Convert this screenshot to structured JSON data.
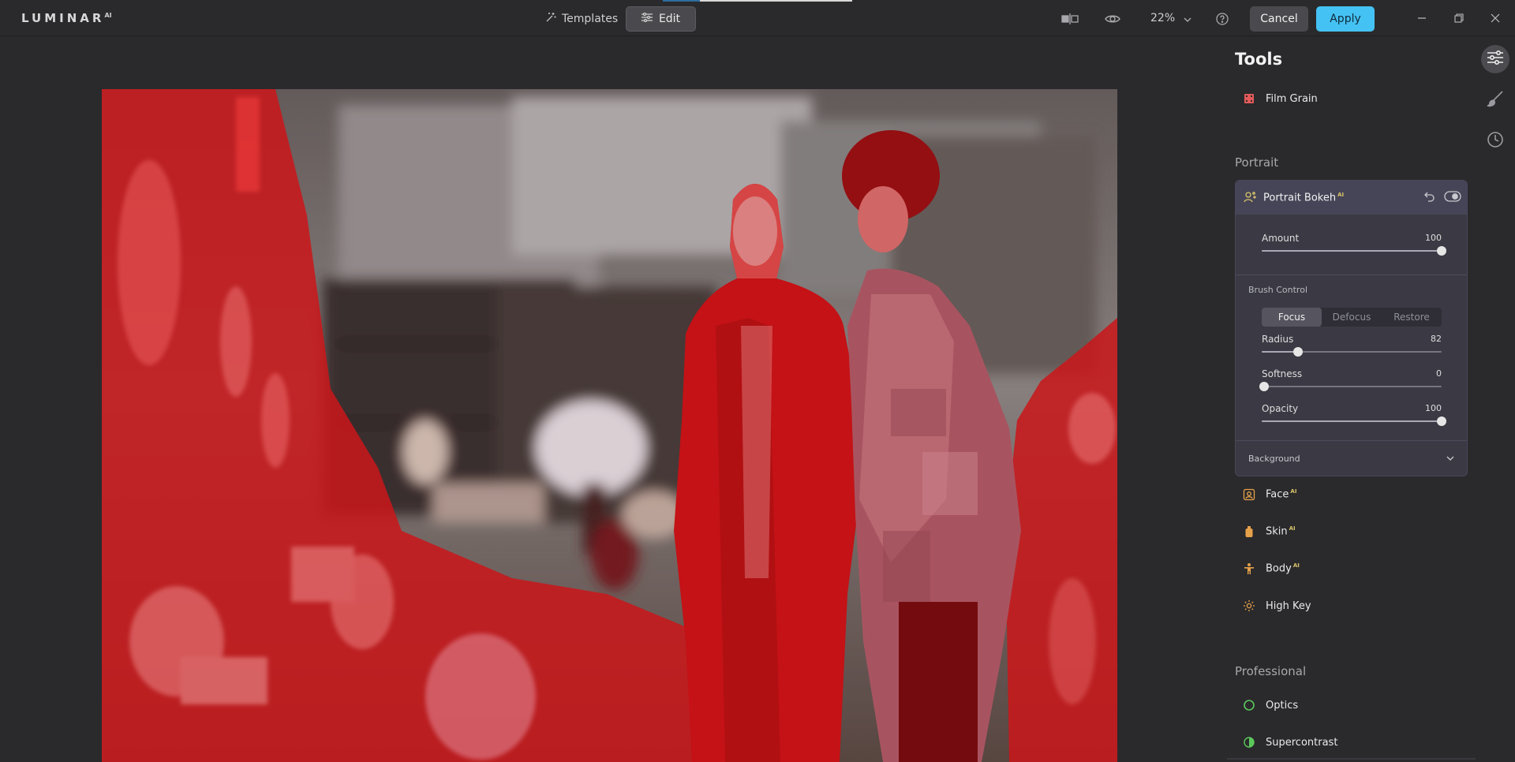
{
  "app": {
    "logo": "LUMINAR",
    "logo_suffix": "AI"
  },
  "topbar": {
    "templates_label": "Templates",
    "edit_label": "Edit",
    "zoom": "22%",
    "cancel_label": "Cancel",
    "apply_label": "Apply",
    "load_progress": 0.8
  },
  "panel": {
    "title": "Tools",
    "top_tool": "Film Grain",
    "section_portrait": "Portrait",
    "bokeh": {
      "title": "Portrait Bokeh",
      "ai": "AI",
      "amount_label": "Amount",
      "amount_value": "100",
      "brush_label": "Brush Control",
      "modes": [
        "Focus",
        "Defocus",
        "Restore"
      ],
      "active_mode": "Focus",
      "radius_label": "Radius",
      "radius_value": "82",
      "softness_label": "Softness",
      "softness_value": "0",
      "opacity_label": "Opacity",
      "opacity_value": "100",
      "background_label": "Background"
    },
    "portrait_tools": [
      {
        "label": "Face",
        "ai": "AI"
      },
      {
        "label": "Skin",
        "ai": "AI"
      },
      {
        "label": "Body",
        "ai": "AI"
      },
      {
        "label": "High Key",
        "ai": ""
      }
    ],
    "section_professional": "Professional",
    "professional_tools": [
      {
        "label": "Optics"
      },
      {
        "label": "Supercontrast"
      }
    ]
  },
  "colors": {
    "accent": "#45c2f4",
    "mask_red": "#e01515",
    "ai_gold": "#d9c46a"
  },
  "icons": [
    "magic-wand-icon",
    "sliders-icon",
    "compare-icon",
    "eye-icon",
    "help-icon",
    "minimize-icon",
    "restore-icon",
    "close-icon",
    "brush-icon",
    "history-icon",
    "film-icon",
    "undo-icon",
    "toggle-eye-icon",
    "face-icon",
    "skin-icon",
    "body-icon",
    "sun-icon",
    "optics-icon",
    "contrast-icon"
  ]
}
